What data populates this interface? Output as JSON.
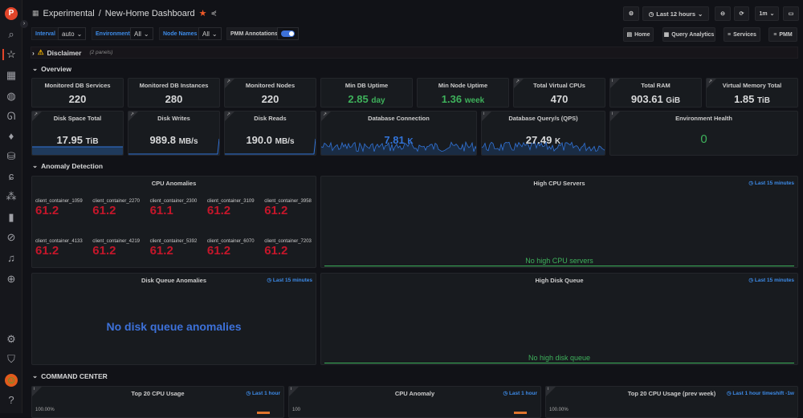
{
  "header": {
    "folder": "Experimental",
    "dashboard": "New-Home Dashboard",
    "time_range": "Last 12 hours",
    "refresh": "1m"
  },
  "variables": [
    {
      "label": "Interval",
      "value": "auto"
    },
    {
      "label": "Environment",
      "value": "All"
    },
    {
      "label": "Node Names",
      "value": "All"
    }
  ],
  "annotations": {
    "label": "PMM Annotations",
    "enabled": true
  },
  "links": [
    "Home",
    "Query Analytics",
    "Services",
    "PMM"
  ],
  "rows": {
    "disclaimer": "Disclaimer",
    "disclaimer_note": "(2 panels)",
    "overview": "Overview",
    "anomaly": "Anomaly Detection",
    "command": "COMMAND CENTER"
  },
  "stats_row1": [
    {
      "title": "Monitored DB Services",
      "value": "220",
      "unit": ""
    },
    {
      "title": "Monitored DB Instances",
      "value": "280",
      "unit": ""
    },
    {
      "title": "Monitored Nodes",
      "value": "220",
      "unit": ""
    },
    {
      "title": "Min DB Uptime",
      "value": "2.85",
      "unit": "day"
    },
    {
      "title": "Min Node Uptime",
      "value": "1.36",
      "unit": "week"
    },
    {
      "title": "Total Virtual CPUs",
      "value": "470",
      "unit": ""
    },
    {
      "title": "Total RAM",
      "value": "903.61",
      "unit": "GiB"
    },
    {
      "title": "Virtual Memory Total",
      "value": "1.85",
      "unit": "TiB"
    }
  ],
  "stats_row2": [
    {
      "title": "Disk Space Total",
      "value": "17.95",
      "unit": "TiB"
    },
    {
      "title": "Disk Writes",
      "value": "989.8",
      "unit": "MB/s"
    },
    {
      "title": "Disk Reads",
      "value": "190.0",
      "unit": "MB/s"
    },
    {
      "title": "Database Connection",
      "value": "7.81",
      "unit": "K"
    },
    {
      "title": "Database Query/s (QPS)",
      "value": "27.49",
      "unit": "K"
    },
    {
      "title": "Environment Health",
      "value": "0",
      "unit": ""
    }
  ],
  "cpu_anomalies": {
    "title": "CPU Anomalies",
    "items": [
      {
        "name": "client_container_1059",
        "value": "61.2"
      },
      {
        "name": "client_container_2270",
        "value": "61.2"
      },
      {
        "name": "client_container_2300",
        "value": "61.1"
      },
      {
        "name": "client_container_3109",
        "value": "61.2"
      },
      {
        "name": "client_container_3958",
        "value": "61.2"
      },
      {
        "name": "client_container_4133",
        "value": "61.2"
      },
      {
        "name": "client_container_4219",
        "value": "61.2"
      },
      {
        "name": "client_container_5392",
        "value": "61.2"
      },
      {
        "name": "client_container_6070",
        "value": "61.2"
      },
      {
        "name": "client_container_7203",
        "value": "61.2"
      }
    ]
  },
  "high_cpu": {
    "title": "High CPU Servers",
    "range": "Last 15 minutes",
    "empty": "No high CPU servers"
  },
  "disk_queue": {
    "title": "Disk Queue Anomalies",
    "range": "Last 15 minutes",
    "empty": "No disk queue anomalies"
  },
  "high_disk": {
    "title": "High Disk Queue",
    "range": "Last 15 minutes",
    "empty": "No high disk queue"
  },
  "command": [
    {
      "title": "Top 20 CPU Usage",
      "range": "Last 1 hour",
      "axis": "100.00%"
    },
    {
      "title": "CPU Anomaly",
      "range": "Last 1 hour",
      "axis": "100"
    },
    {
      "title": "Top 20 CPU Usage (prev week)",
      "range": "Last 1 hour timeshift -1w",
      "axis": "100.00%"
    }
  ],
  "colors": {
    "accent": "#3d8be8",
    "ok": "#3eb15b",
    "alert": "#c4162a",
    "spark": "#3274d9"
  }
}
